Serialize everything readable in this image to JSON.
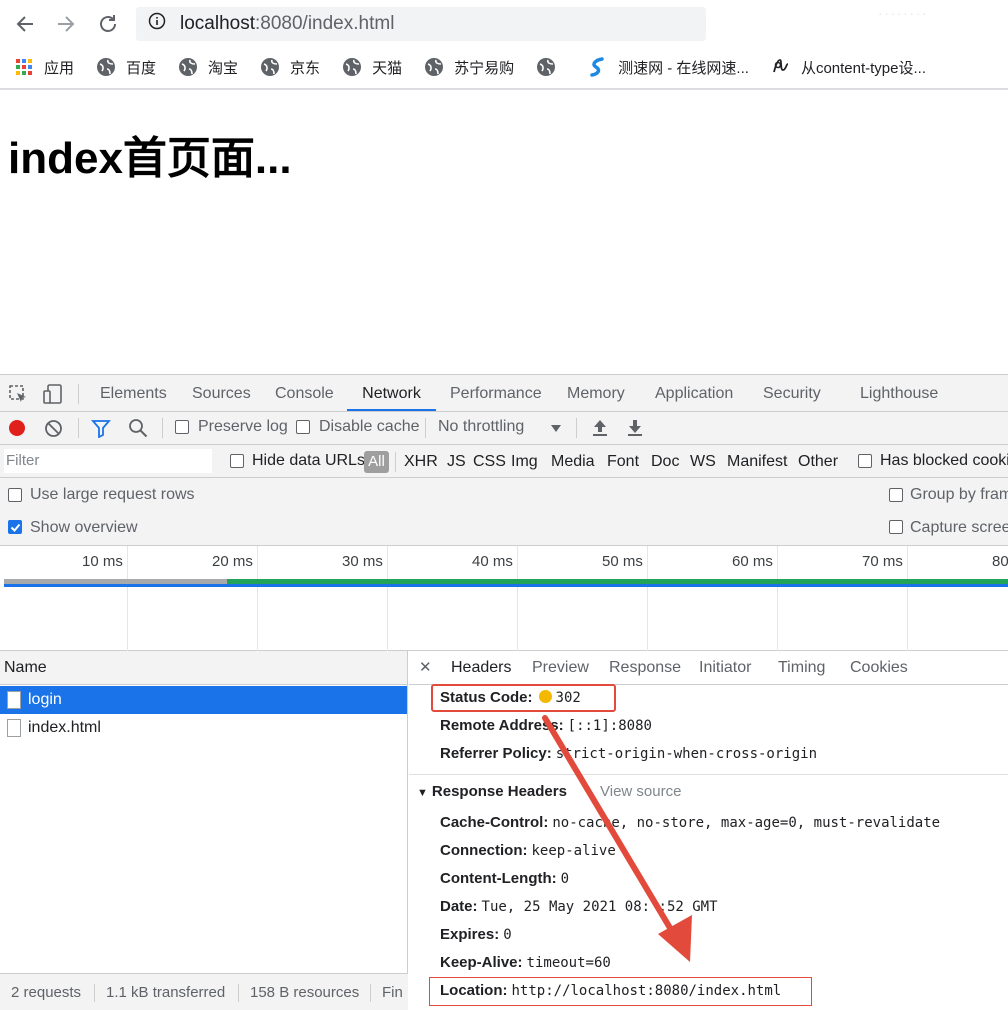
{
  "browser": {
    "url_host": "localhost",
    "url_path": ":8080/index.html",
    "profile_text": "········",
    "bookmarks": [
      {
        "label": "应用",
        "icon": "apps-grid-icon"
      },
      {
        "label": "百度",
        "icon": "globe-icon"
      },
      {
        "label": "淘宝",
        "icon": "globe-icon"
      },
      {
        "label": "京东",
        "icon": "globe-icon"
      },
      {
        "label": "天猫",
        "icon": "globe-icon"
      },
      {
        "label": "苏宁易购",
        "icon": "globe-icon"
      },
      {
        "label": "",
        "icon": "globe-icon"
      },
      {
        "label": "测速网 - 在线网速...",
        "icon": "speedtest-icon"
      },
      {
        "label": "从content-type设...",
        "icon": "bookmark-glyph-icon"
      }
    ]
  },
  "page": {
    "title": "index首页面..."
  },
  "devtools": {
    "tabs": [
      "Elements",
      "Sources",
      "Console",
      "Network",
      "Performance",
      "Memory",
      "Application",
      "Security",
      "Lighthouse"
    ],
    "active_tab": "Network",
    "toolbar": {
      "preserve_log": "Preserve log",
      "disable_cache": "Disable cache",
      "throttling": "No throttling"
    },
    "filter": {
      "placeholder": "Filter",
      "hide_data_urls": "Hide data URLs",
      "types": [
        "All",
        "XHR",
        "JS",
        "CSS",
        "Img",
        "Media",
        "Font",
        "Doc",
        "WS",
        "Manifest",
        "Other"
      ],
      "has_blocked": "Has blocked cookie"
    },
    "options": {
      "large_rows": "Use large request rows",
      "group_by_frame": "Group by fram",
      "show_overview": "Show overview",
      "show_overview_checked": true,
      "capture_screenshots": "Capture screen"
    },
    "timeline": {
      "ticks": [
        "10 ms",
        "20 ms",
        "30 ms",
        "40 ms",
        "50 ms",
        "60 ms",
        "70 ms",
        "80"
      ]
    },
    "requests": {
      "column": "Name",
      "rows": [
        {
          "name": "login",
          "selected": true
        },
        {
          "name": "index.html",
          "selected": false
        }
      ]
    },
    "details": {
      "tabs": [
        "Headers",
        "Preview",
        "Response",
        "Initiator",
        "Timing",
        "Cookies"
      ],
      "active_tab": "Headers",
      "general": [
        {
          "key": "Status Code:",
          "value": "302"
        },
        {
          "key": "Remote Address:",
          "value": "[::1]:8080"
        },
        {
          "key": "Referrer Policy:",
          "value": "strict-origin-when-cross-origin"
        }
      ],
      "response_headers_title": "Response Headers",
      "view_source": "View source",
      "response_headers": [
        {
          "key": "Cache-Control:",
          "value": "no-cache, no-store, max-age=0, must-revalidate"
        },
        {
          "key": "Connection:",
          "value": "keep-alive"
        },
        {
          "key": "Content-Length:",
          "value": "0"
        },
        {
          "key": "Date:",
          "value": "Tue, 25 May 2021 08:  :52 GMT"
        },
        {
          "key": "Expires:",
          "value": "0"
        },
        {
          "key": "Keep-Alive:",
          "value": "timeout=60"
        },
        {
          "key": "Location:",
          "value": "http://localhost:8080/index.html"
        }
      ]
    },
    "status_bar": [
      "2 requests",
      "1.1 kB transferred",
      "158 B resources",
      "Fin"
    ]
  },
  "colors": {
    "accent": "#1a73e8",
    "annotation_red": "#e24a3b",
    "status_yellow": "#f5b800",
    "timeline_green": "#21a35a"
  }
}
